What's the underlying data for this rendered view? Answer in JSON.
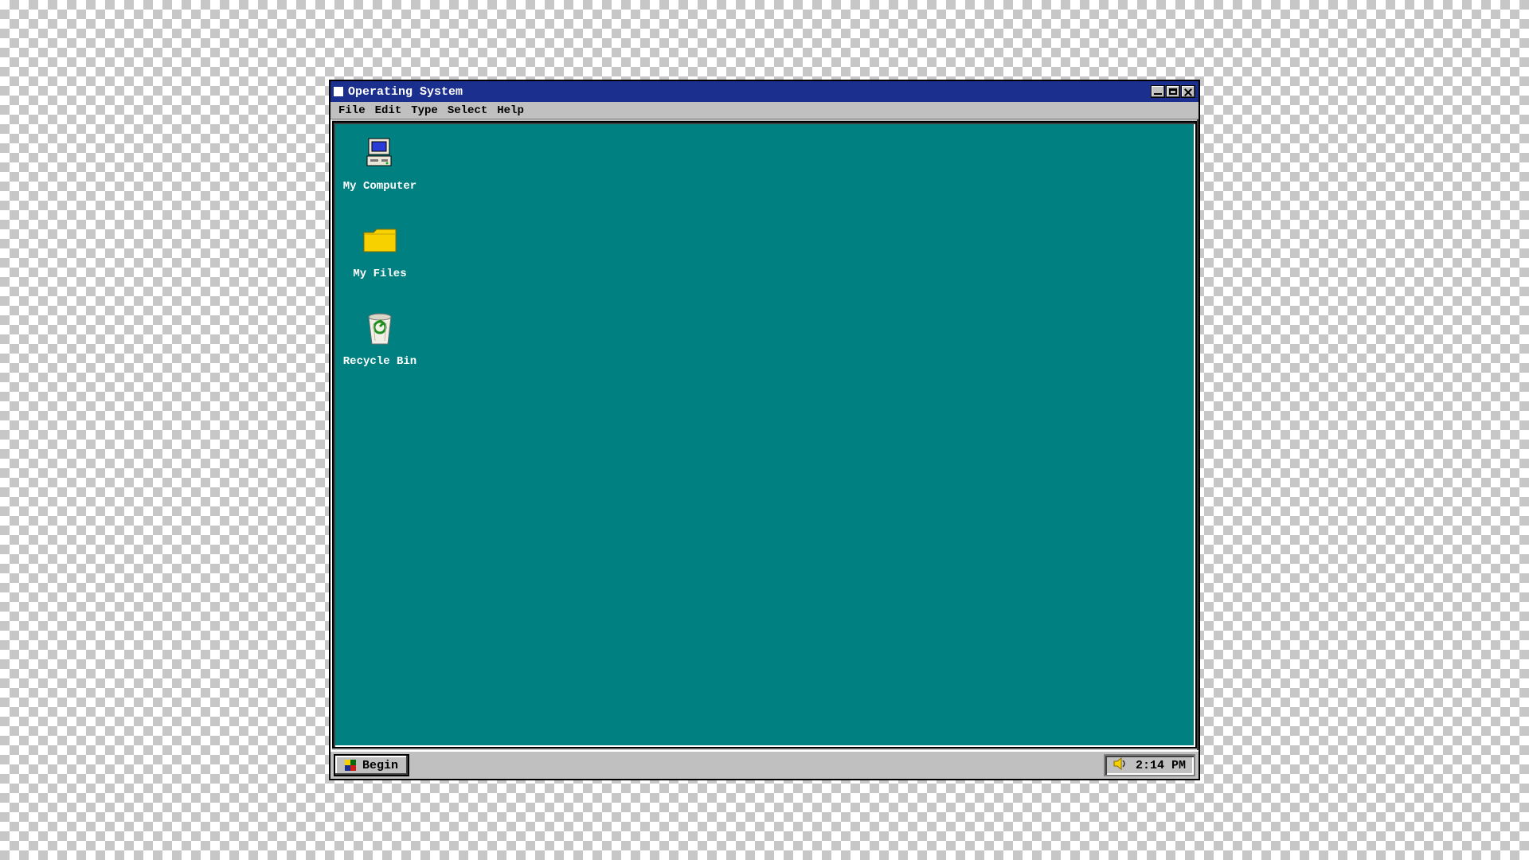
{
  "window": {
    "title": "Operating System"
  },
  "menu": {
    "file": "File",
    "edit": "Edit",
    "type": "Type",
    "select": "Select",
    "help": "Help"
  },
  "desktop": {
    "my_computer": "My Computer",
    "my_files": "My Files",
    "recycle_bin": "Recycle Bin"
  },
  "taskbar": {
    "begin": "Begin",
    "clock": "2:14 PM"
  },
  "colors": {
    "desktop_bg": "#008080",
    "titlebar_bg": "#1b2f8f",
    "chrome": "#c0c0c0"
  }
}
